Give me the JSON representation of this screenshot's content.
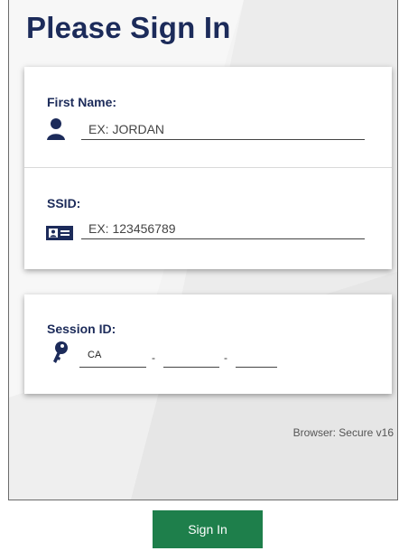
{
  "title": "Please Sign In",
  "first_name": {
    "label": "First Name:",
    "placeholder": "EX: JORDAN",
    "icon": "person-icon"
  },
  "ssid": {
    "label": "SSID:",
    "placeholder": "EX: 123456789",
    "icon": "id-card-icon"
  },
  "session": {
    "label": "Session ID:",
    "prefix": "CA",
    "part2": "",
    "part3": "",
    "separator": "-",
    "icon": "key-icon"
  },
  "browser_text": "Browser: Secure v16",
  "sign_in_label": "Sign In",
  "colors": {
    "title": "#1c2b5a",
    "button": "#1e7f4b"
  }
}
